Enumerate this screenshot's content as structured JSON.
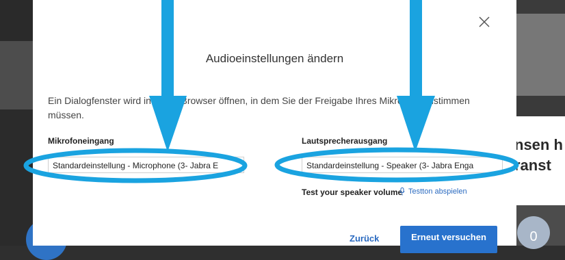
{
  "background": {
    "right_text_line1": "nsen h",
    "right_text_line2": "ranst",
    "right_circle_text": "0"
  },
  "dialog": {
    "title": "Audioeinstellungen ändern",
    "description": "Ein Dialogfenster wird in Ihrem Browser öffnen, in dem Sie der Freigabe Ihres Mikrofons zustimmen müssen.",
    "microphone": {
      "label": "Mikrofoneingang",
      "selected": "Standardeinstellung - Microphone (3- Jabra E"
    },
    "speaker": {
      "label": "Lautsprecherausgang",
      "selected": "Standardeinstellung - Speaker (3- Jabra Enga"
    },
    "test_volume_label": "Test your speaker volume",
    "test_tone_link": "Testton abspielen",
    "back_button": "Zurück",
    "retry_button": "Erneut versuchen"
  },
  "annotations": {
    "arrow_color": "#1aa3e0",
    "ellipse_color": "#1aa3e0"
  }
}
